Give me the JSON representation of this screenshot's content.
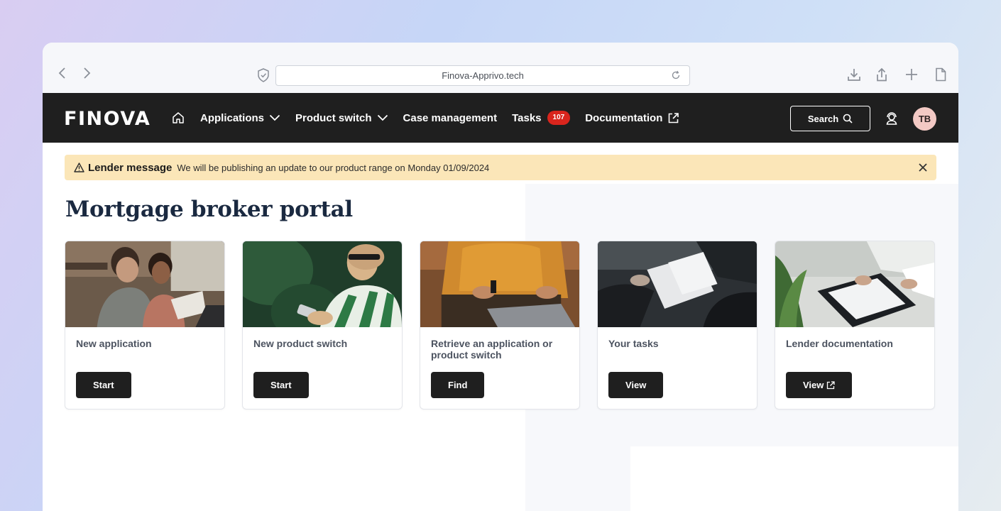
{
  "browser": {
    "url": "Finova-Apprivo.tech"
  },
  "header": {
    "logo": "FINOVA",
    "nav": [
      {
        "label": "Applications"
      },
      {
        "label": "Product switch"
      },
      {
        "label": "Case management"
      },
      {
        "label": "Tasks",
        "badge": "107"
      },
      {
        "label": "Documentation"
      }
    ],
    "search_label": "Search",
    "avatar_initials": "TB"
  },
  "banner": {
    "label": "Lender message",
    "text": "We will be publishing an update to our product range on Monday 01/09/2024"
  },
  "page_title": "Mortgage broker portal",
  "cards": [
    {
      "title": "New application",
      "button": "Start"
    },
    {
      "title": "New product switch",
      "button": "Start"
    },
    {
      "title": "Retrieve an application or product switch",
      "button": "Find"
    },
    {
      "title": "Your tasks",
      "button": "View"
    },
    {
      "title": "Lender documentation",
      "button": "View"
    }
  ],
  "colors": {
    "header_bg": "#1f1f1f",
    "badge": "#d9251d",
    "banner_bg": "#fbe6b8",
    "title": "#1a2940",
    "avatar_bg": "#f3c9c4"
  }
}
